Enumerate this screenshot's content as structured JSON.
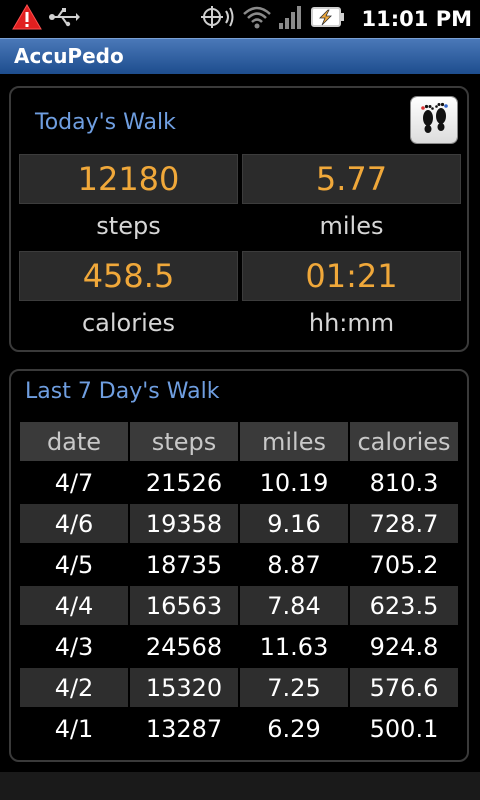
{
  "status_bar": {
    "time": "11:01 PM",
    "icons": [
      "warning-icon",
      "usb-icon",
      "gps-icon",
      "wifi-icon",
      "signal-icon",
      "battery-charging-icon"
    ]
  },
  "app": {
    "title": "AccuPedo"
  },
  "today": {
    "title": "Today's Walk",
    "stats": [
      {
        "value": "12180",
        "label": "steps"
      },
      {
        "value": "5.77",
        "label": "miles"
      },
      {
        "value": "458.5",
        "label": "calories"
      },
      {
        "value": "01:21",
        "label": "hh:mm"
      }
    ],
    "button_icon": "footprints-icon",
    "accent_color": "#f0a83a"
  },
  "week": {
    "title": "Last 7 Day's Walk",
    "columns": [
      "date",
      "steps",
      "miles",
      "calories"
    ],
    "rows": [
      [
        "4/7",
        "21526",
        "10.19",
        "810.3"
      ],
      [
        "4/6",
        "19358",
        "9.16",
        "728.7"
      ],
      [
        "4/5",
        "18735",
        "8.87",
        "705.2"
      ],
      [
        "4/4",
        "16563",
        "7.84",
        "623.5"
      ],
      [
        "4/3",
        "24568",
        "11.63",
        "924.8"
      ],
      [
        "4/2",
        "15320",
        "7.25",
        "576.6"
      ],
      [
        "4/1",
        "13287",
        "6.29",
        "500.1"
      ]
    ]
  }
}
